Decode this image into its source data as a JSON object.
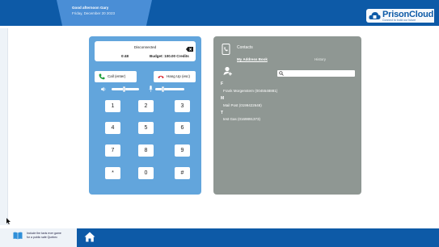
{
  "header": {
    "greeting": "Good afternoon Gary",
    "date": "Friday, December 20 2023",
    "logo_text": "PrisonCloud",
    "logo_tagline": "Connect to build our future"
  },
  "phone": {
    "status": "Disconnected",
    "time": "0:48",
    "budget": "Budget: 100.00 Credits",
    "call_label": "Call (enter)",
    "hang_label": "Hang Up (esc)",
    "keys": [
      "1",
      "2",
      "3",
      "4",
      "5",
      "6",
      "7",
      "8",
      "9",
      "*",
      "0",
      "#"
    ]
  },
  "contacts": {
    "title": "Contacts",
    "tab_address_book": "My Address Book",
    "tab_history": "History",
    "search_placeholder": "",
    "groups": [
      {
        "letter": "F",
        "entries": [
          "Frank Morgenstern (0045548881)"
        ]
      },
      {
        "letter": "M",
        "entries": [
          "Mail Post (0199422648)"
        ]
      },
      {
        "letter": "T",
        "entries": [
          "test Gas (0169891373)"
        ]
      }
    ]
  },
  "footer": {
    "line1": "Include the taxis ever game",
    "line2": "for a public safe Quebec"
  },
  "colors": {
    "brand_blue": "#0d5aa7",
    "phone_card": "#62a5dc",
    "contacts_card": "#8f9793",
    "call_green": "#1f9d3a",
    "hang_red": "#d9232d"
  }
}
